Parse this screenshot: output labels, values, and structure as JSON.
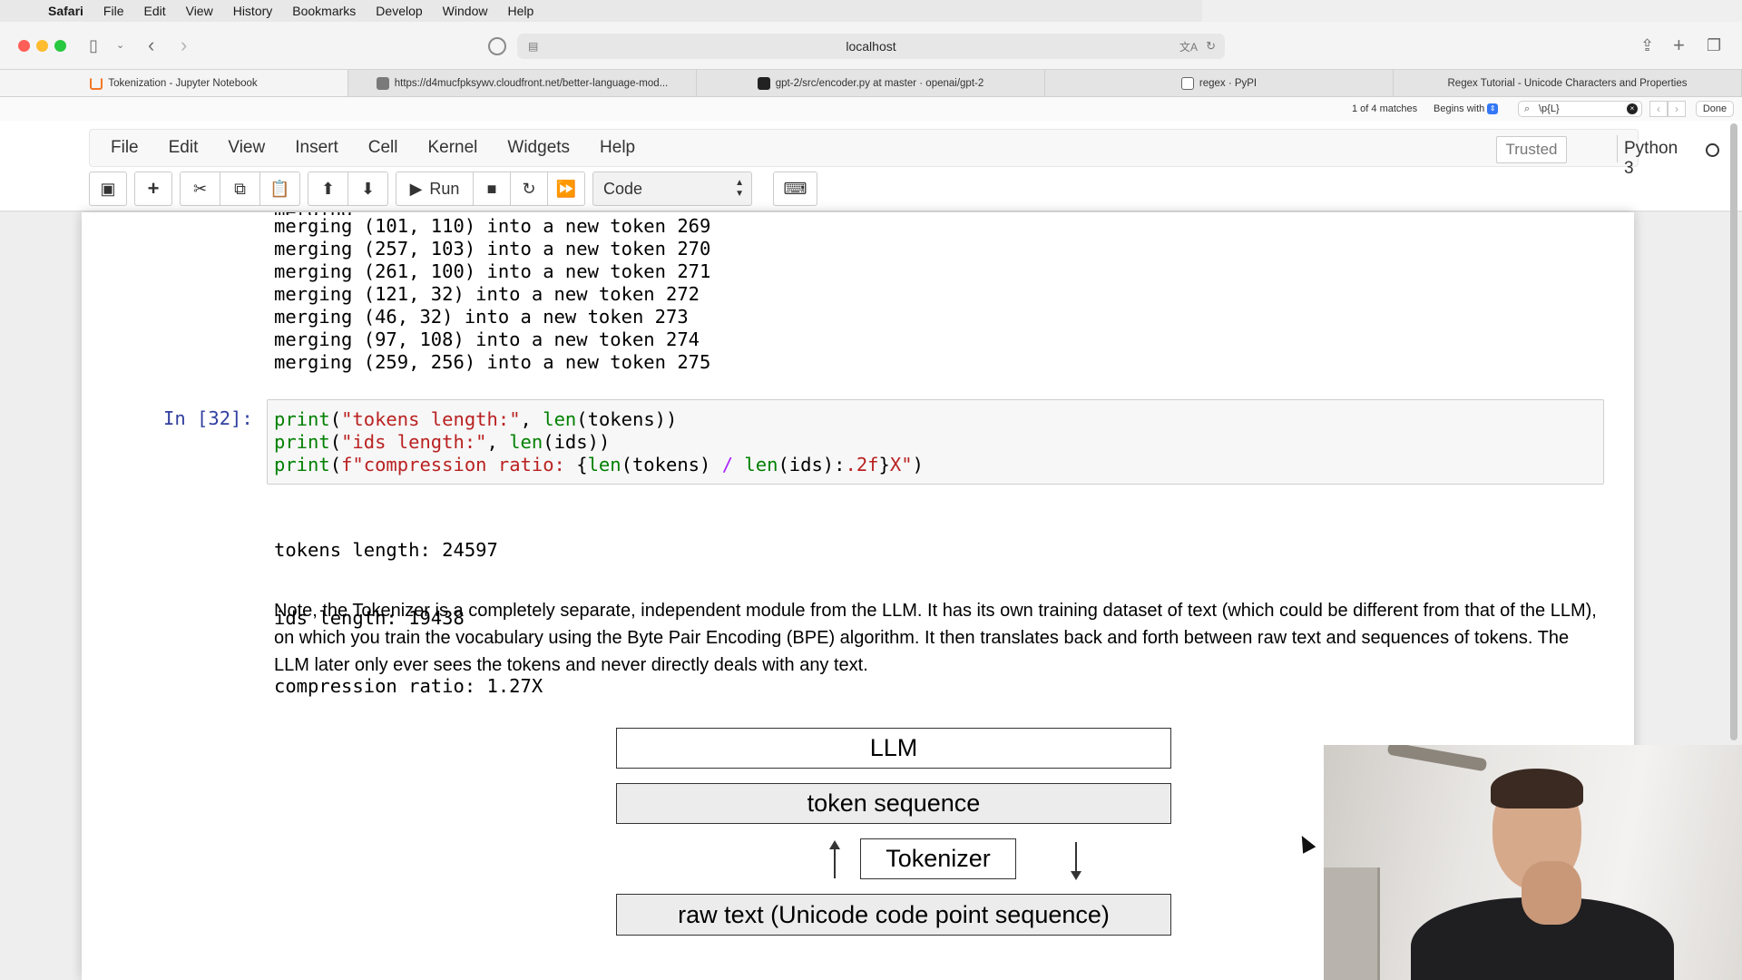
{
  "mac_menu": {
    "app": "Safari",
    "items": [
      "File",
      "Edit",
      "View",
      "History",
      "Bookmarks",
      "Develop",
      "Window",
      "Help"
    ]
  },
  "address_bar": {
    "url": "localhost"
  },
  "tabs": [
    {
      "title": "Tokenization - Jupyter Notebook",
      "active": true
    },
    {
      "title": "https://d4mucfpksywv.cloudfront.net/better-language-mod...",
      "active": false
    },
    {
      "title": "gpt-2/src/encoder.py at master · openai/gpt-2",
      "active": false
    },
    {
      "title": "regex · PyPI",
      "active": false
    },
    {
      "title": "Regex Tutorial - Unicode Characters and Properties",
      "active": false
    }
  ],
  "find_bar": {
    "matches": "1 of 4 matches",
    "mode": "Begins with",
    "query": "\\p{L}",
    "done_label": "Done"
  },
  "jupyter_menu": [
    "File",
    "Edit",
    "View",
    "Insert",
    "Cell",
    "Kernel",
    "Widgets",
    "Help"
  ],
  "jupyter_status": {
    "trusted": "Trusted",
    "kernel": "Python 3"
  },
  "jupyter_toolbar": {
    "run_label": "Run",
    "cell_type": "Code"
  },
  "output_merges": [
    "merging (101, 110) into a new token 269",
    "merging (257, 103) into a new token 270",
    "merging (261, 100) into a new token 271",
    "merging (121, 32) into a new token 272",
    "merging (46, 32) into a new token 273",
    "merging (97, 108) into a new token 274",
    "merging (259, 256) into a new token 275"
  ],
  "cell": {
    "prompt": "In [32]:",
    "code_lines": [
      [
        [
          "kw",
          "print"
        ],
        [
          "plain",
          "("
        ],
        [
          "str",
          "\"tokens length:\""
        ],
        [
          "plain",
          ", "
        ],
        [
          "kw",
          "len"
        ],
        [
          "plain",
          "(tokens))"
        ]
      ],
      [
        [
          "kw",
          "print"
        ],
        [
          "plain",
          "("
        ],
        [
          "str",
          "\"ids length:\""
        ],
        [
          "plain",
          ", "
        ],
        [
          "kw",
          "len"
        ],
        [
          "plain",
          "(ids))"
        ]
      ],
      [
        [
          "kw",
          "print"
        ],
        [
          "plain",
          "("
        ],
        [
          "str",
          "f\"compression ratio: "
        ],
        [
          "plain",
          "{"
        ],
        [
          "kw",
          "len"
        ],
        [
          "plain",
          "(tokens) "
        ],
        [
          "op",
          "/"
        ],
        [
          "plain",
          " "
        ],
        [
          "kw",
          "len"
        ],
        [
          "plain",
          "(ids):"
        ],
        [
          "str",
          ".2f"
        ],
        [
          "plain",
          "}"
        ],
        [
          "str",
          "X\""
        ],
        [
          "plain",
          ")"
        ]
      ]
    ],
    "output_lines": [
      "tokens length: 24597",
      "ids length: 19438",
      "compression ratio: 1.27X"
    ]
  },
  "note_text": "Note, the Tokenizer is a completely separate, independent module from the LLM. It has its own training dataset of text (which could be different from that of the LLM), on which you train the vocabulary using the Byte Pair Encoding (BPE) algorithm. It then translates back and forth between raw text and sequences of tokens. The LLM later only ever sees the tokens and never directly deals with any text.",
  "diagram": {
    "llm": "LLM",
    "token_sequence": "token sequence",
    "tokenizer": "Tokenizer",
    "raw_text": "raw text (Unicode code point sequence)"
  },
  "colors": {
    "prompt": "#303f9f",
    "keyword": "#008000",
    "string": "#ba2121",
    "operator": "#aa22ff"
  }
}
